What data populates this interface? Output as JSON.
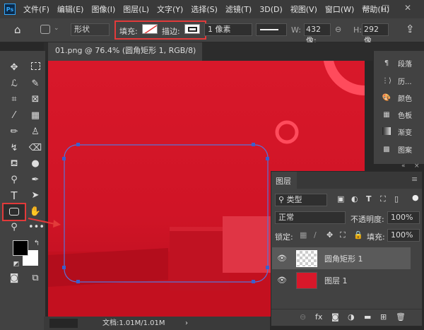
{
  "app": {
    "logo": "Ps"
  },
  "menu": [
    "文件(F)",
    "编辑(E)",
    "图像(I)",
    "图层(L)",
    "文字(Y)",
    "选择(S)",
    "滤镜(T)",
    "3D(D)",
    "视图(V)",
    "窗口(W)",
    "帮助(H)"
  ],
  "window_controls": {
    "minimize": "—",
    "maximize": "□",
    "close": "✕"
  },
  "options": {
    "mode": "形状",
    "fill_label": "填充:",
    "stroke_label": "描边:",
    "stroke_width": "1 像素",
    "w_label": "W:",
    "w_value": "432 像:",
    "h_label": "H:",
    "h_value": "292 像"
  },
  "document_tab": {
    "title": "01.png @ 76.4% (圆角矩形 1, RGB/8) *",
    "close": "×"
  },
  "status": {
    "doc": "文档:1.01M/1.01M",
    "arrow": "›"
  },
  "right_panel": {
    "items": [
      {
        "label": "段落",
        "icon": "paragraph-icon"
      },
      {
        "label": "历...",
        "icon": "history-icon"
      },
      {
        "label": "颜色",
        "icon": "color-palette-icon"
      },
      {
        "label": "色板",
        "icon": "swatches-icon"
      },
      {
        "label": "渐变",
        "icon": "gradient-icon"
      },
      {
        "label": "图案",
        "icon": "pattern-icon"
      }
    ],
    "collapse": "«",
    "close": "×"
  },
  "layers": {
    "title": "图层",
    "filter": "类型",
    "blend": "正常",
    "opacity_label": "不透明度:",
    "opacity": "100%",
    "lock_label": "锁定:",
    "fill_label": "填充:",
    "fill": "100%",
    "items": [
      {
        "name": "圆角矩形 1",
        "selected": true
      },
      {
        "name": "图层 1",
        "selected": false
      }
    ]
  },
  "colors": {
    "accent": "#e23a3a",
    "canvas": "#d8182a",
    "path": "#3a5fcd"
  }
}
